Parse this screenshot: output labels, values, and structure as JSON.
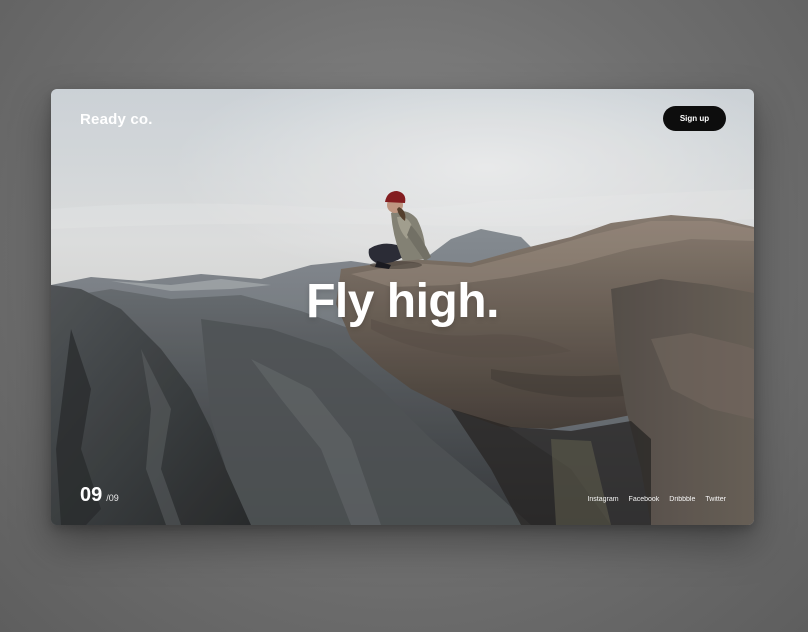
{
  "brand": {
    "name": "Ready co."
  },
  "header": {
    "signup_label": "Sign up"
  },
  "hero": {
    "headline": "Fly high."
  },
  "slider": {
    "current": "09",
    "total": "/09"
  },
  "social": {
    "links": [
      "Instagram",
      "Facebook",
      "Dribbble",
      "Twitter"
    ]
  },
  "colors": {
    "page_background": "#6f6f6f",
    "button_background": "#0d0d0d",
    "text": "#ffffff"
  }
}
